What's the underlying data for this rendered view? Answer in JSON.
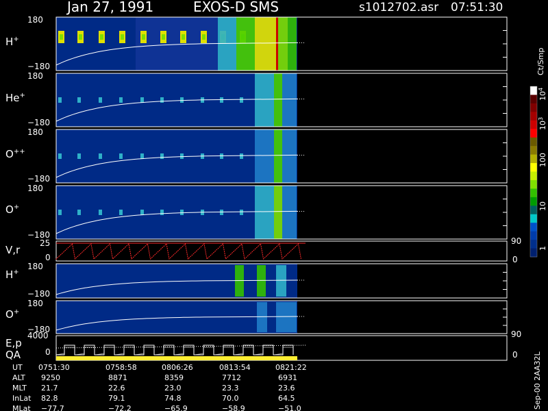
{
  "header": {
    "date": "Jan 27, 1991",
    "instrument": "EXOS-D SMS",
    "file": "s1012702.asr",
    "time": "07:51:30"
  },
  "footer": {
    "version": "Sep-00 2AA32L"
  },
  "chart_data": {
    "type": "heatmap",
    "time_range": [
      "0751:30",
      "0828:00"
    ],
    "data_end": "0829:30",
    "panels": [
      {
        "base": "H",
        "sup": "+",
        "ylim": [
          -180,
          180
        ],
        "ytick_labels": [
          "180",
          "−180"
        ]
      },
      {
        "base": "He",
        "sup": "+",
        "ylim": [
          -180,
          180
        ],
        "ytick_labels": [
          "180",
          "−180"
        ]
      },
      {
        "base": "O",
        "sup": "++",
        "ylim": [
          -180,
          180
        ],
        "ytick_labels": [
          "180",
          "−180"
        ]
      },
      {
        "base": "O",
        "sup": "+",
        "ylim": [
          -180,
          180
        ],
        "ytick_labels": [
          "180",
          "−180"
        ]
      },
      {
        "base": "H",
        "sup": "+",
        "ylim": [
          -180,
          180
        ],
        "ytick_labels": [
          "180",
          "−180"
        ]
      },
      {
        "base": "O",
        "sup": "+",
        "ylim": [
          -180,
          180
        ],
        "ytick_labels": [
          "180",
          "−180"
        ]
      }
    ],
    "vr": {
      "label": "V,r",
      "left_ticks": [
        "25",
        "0"
      ],
      "right_ticks": [
        "90",
        "0"
      ],
      "series_color": "#ff2a2a"
    },
    "ep": {
      "label": "E,p",
      "qa_label": "QA",
      "left_ticks": [
        "4000",
        "0"
      ],
      "right_ticks": [
        "90",
        "0"
      ],
      "qa_color": "#ffee33"
    },
    "colorbar": {
      "unit": "Ct/Smp",
      "tick_labels": [
        {
          "base": "10",
          "sup": "4"
        },
        {
          "base": "10",
          "sup": "3"
        },
        {
          "base": "100",
          "sup": ""
        },
        {
          "base": "10",
          "sup": ""
        },
        {
          "base": "1",
          "sup": ""
        }
      ],
      "colors": [
        "#ffffff",
        "#5a0000",
        "#800000",
        "#a40000",
        "#cc0000",
        "#ff0000",
        "#6b5a00",
        "#8a7a00",
        "#b5b000",
        "#ffff00",
        "#c8f000",
        "#80e000",
        "#33c000",
        "#009c00",
        "#006060",
        "#00c8c8",
        "#0050c8",
        "#003caa",
        "#002f8c",
        "#002070"
      ]
    },
    "axis_table": {
      "rows": [
        {
          "label": "UT",
          "values": [
            "0751:30",
            "0758:58",
            "0806:26",
            "0813:54",
            "0821:22"
          ]
        },
        {
          "label": "ALT",
          "values": [
            "9250",
            "8871",
            "8359",
            "7712",
            "6931"
          ]
        },
        {
          "label": "MLT",
          "values": [
            "21.7",
            "22.6",
            "23.0",
            "23.3",
            "23.6"
          ]
        },
        {
          "label": "InLat",
          "values": [
            "82.8",
            "79.1",
            "74.8",
            "70.0",
            "64.5"
          ]
        },
        {
          "label": "MLat",
          "values": [
            "−77.7",
            "−72.2",
            "−65.9",
            "−58.9",
            "−51.0"
          ]
        }
      ]
    }
  }
}
